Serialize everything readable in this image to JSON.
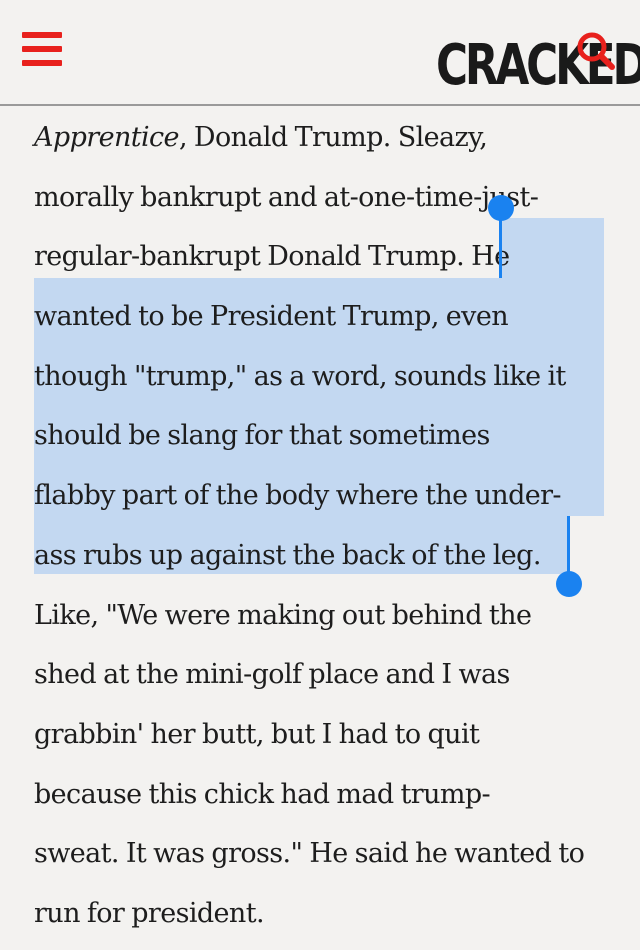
{
  "header": {
    "logo": "CRACKED",
    "menu_icon": "hamburger-menu-icon",
    "search_icon": "search-icon",
    "accent_color": "#e8211d"
  },
  "article": {
    "lines": [
      {
        "pre_em": "",
        "em": "Apprentice",
        "text": ", Donald Trump. Sleazy,",
        "sel": ""
      },
      {
        "text": "morally bankrupt and at-one-time-just-",
        "sel": ""
      },
      {
        "text": "regular-bankrupt Donald Trump. ",
        "sel": "He"
      },
      {
        "text": "",
        "sel": "wanted to be President Trump, even"
      },
      {
        "text": "",
        "sel": "though \"trump,\" as a word, sounds like it"
      },
      {
        "text": "",
        "sel": "should be slang for that sometimes"
      },
      {
        "text": "",
        "sel": "flabby part of the body where the under-"
      },
      {
        "text": "",
        "sel": "ass rubs up against the back of the leg."
      },
      {
        "text": "Like, \"We were making out behind the",
        "sel": ""
      },
      {
        "text": "shed at the mini-golf place and I was",
        "sel": ""
      },
      {
        "text": "grabbin' her butt, but I had to quit",
        "sel": ""
      },
      {
        "text": "because this chick had mad trump-",
        "sel": ""
      },
      {
        "text": "sweat. It was gross.\" He said he wanted to",
        "sel": ""
      },
      {
        "text": "run for president.",
        "sel": ""
      }
    ]
  },
  "selection": {
    "highlight_color": "#c3d8f1",
    "handle_color": "#1a82f0"
  }
}
